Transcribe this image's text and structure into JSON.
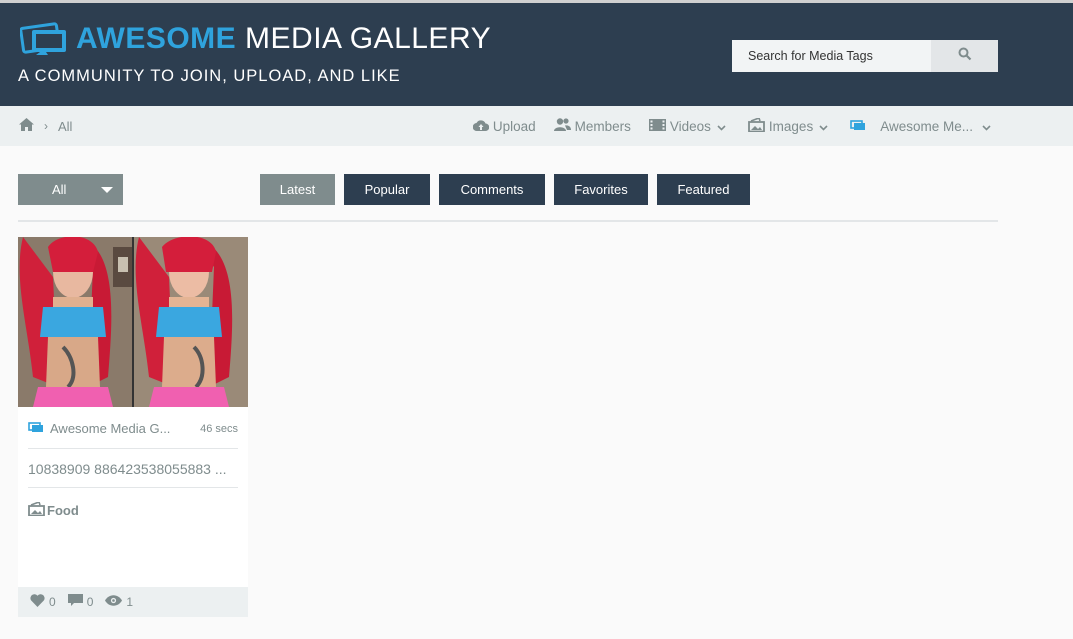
{
  "header": {
    "logo_word1": "AWESOME",
    "logo_word2": "MEDIA GALLERY",
    "tagline": "A COMMUNITY TO JOIN, UPLOAD, AND LIKE",
    "search_placeholder": "Search for Media Tags",
    "colors": {
      "bar": "#2d3e50",
      "accent": "#2fa3dd"
    }
  },
  "breadcrumb": {
    "current": "All"
  },
  "menu": [
    {
      "label": "Upload",
      "icon": "cloud-upload-icon"
    },
    {
      "label": "Members",
      "icon": "users-icon"
    },
    {
      "label": "Videos",
      "icon": "film-icon"
    },
    {
      "label": "Images",
      "icon": "image-icon"
    },
    {
      "label": "Awesome Me...",
      "icon": "logo-icon"
    }
  ],
  "filter": {
    "dropdown_value": "All",
    "tabs": [
      "Latest",
      "Popular",
      "Comments",
      "Favorites",
      "Featured"
    ],
    "active_tab": "Latest"
  },
  "media": [
    {
      "author": "Awesome Media G...",
      "age": "46 secs",
      "title": "10838909 886423538055883 ...",
      "category": "Food",
      "likes": "0",
      "comments": "0",
      "views": "1"
    }
  ]
}
